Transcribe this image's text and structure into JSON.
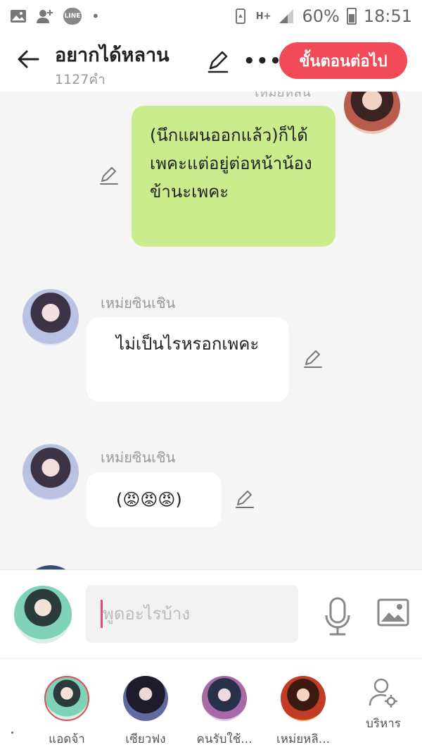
{
  "status_bar": {
    "battery": "60%",
    "time": "18:51",
    "network": "H+",
    "line_label": "LINE"
  },
  "header": {
    "title": "อยากได้หลาน",
    "word_count": "1127คำ",
    "next_button": "ขั้นตอนต่อไป"
  },
  "chat": {
    "cut_off_name": "เหมยหลิน",
    "messages": [
      {
        "side": "me",
        "speaker": "",
        "text": "(นึกแผนออกแล้ว)ก็ได้เพคะแต่อยู่ต่อหน้าน้องข้านะเพคะ"
      },
      {
        "side": "other",
        "speaker": "เหม่ยซินเชิน",
        "text": "ไม่เป็นไรหรอกเพคะ"
      },
      {
        "side": "other",
        "speaker": "เหม่ยซินเชิน",
        "text": "(😡😡😡)"
      }
    ]
  },
  "composer": {
    "placeholder": "พูดอะไรบ้าง"
  },
  "cast_bar": {
    "members": [
      {
        "name": "แอดจ้า",
        "selected": true
      },
      {
        "name": "เซียวฟง",
        "selected": false
      },
      {
        "name": "คนรับใช้...",
        "selected": false
      },
      {
        "name": "เหม่ยหลิ...",
        "selected": false
      }
    ],
    "manage_label": "บริหาร"
  },
  "colors": {
    "accent": "#f24b58",
    "my_bubble": "#c9ec8c",
    "other_bubble": "#ffffff",
    "background": "#f5f5f5"
  }
}
